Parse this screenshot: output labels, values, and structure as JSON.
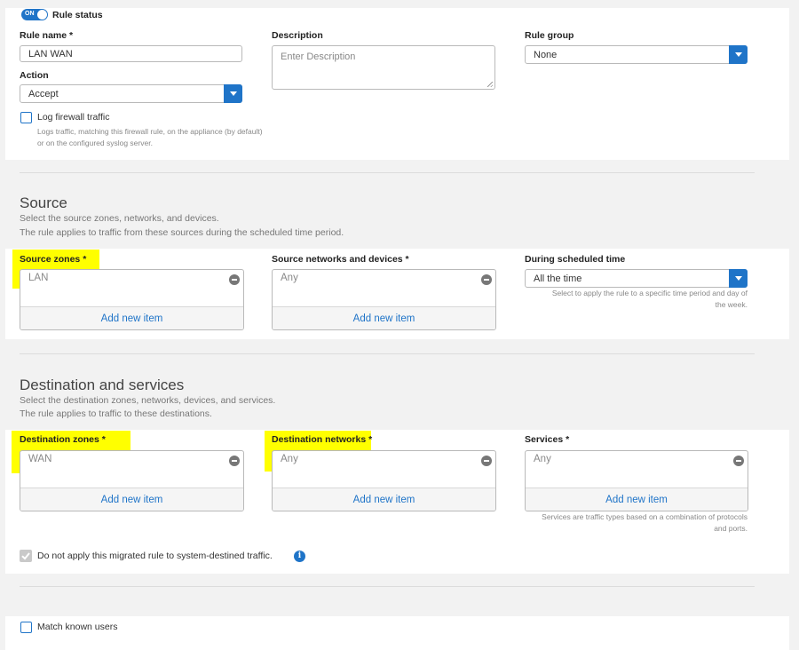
{
  "general": {
    "rule_status_toggle": "ON",
    "rule_status_label": "Rule status",
    "rule_name_label": "Rule name *",
    "rule_name_value": "LAN WAN",
    "description_label": "Description",
    "description_placeholder": "Enter Description",
    "rule_group_label": "Rule group",
    "rule_group_value": "None",
    "action_label": "Action",
    "action_value": "Accept",
    "log_label": "Log firewall traffic",
    "log_hint": "Logs traffic, matching this firewall rule, on the appliance (by default) or on the configured syslog server."
  },
  "source": {
    "title": "Source",
    "desc1": "Select the source zones, networks, and devices.",
    "desc2": "The rule applies to traffic from these sources during the scheduled time period.",
    "zones_label": "Source zones *",
    "zones_item": "LAN",
    "networks_label": "Source networks and devices *",
    "networks_item": "Any",
    "time_label": "During scheduled time",
    "time_value": "All the time",
    "time_hint": "Select to apply the rule to a specific time period and day of the week.",
    "add_item": "Add new item"
  },
  "destination": {
    "title": "Destination and services",
    "desc1": "Select the destination zones, networks, devices, and services.",
    "desc2": "The rule applies to traffic to these destinations.",
    "zones_label": "Destination zones *",
    "zones_item": "WAN",
    "networks_label": "Destination networks *",
    "networks_item": "Any",
    "services_label": "Services *",
    "services_item": "Any",
    "services_hint": "Services are traffic types based on a combination of protocols and ports.",
    "add_item": "Add new item",
    "migrated_label": "Do not apply this migrated rule to system-destined traffic."
  },
  "users": {
    "match_label": "Match known users"
  },
  "colors": {
    "accent": "#1f74c8",
    "highlight": "#ffff00"
  }
}
